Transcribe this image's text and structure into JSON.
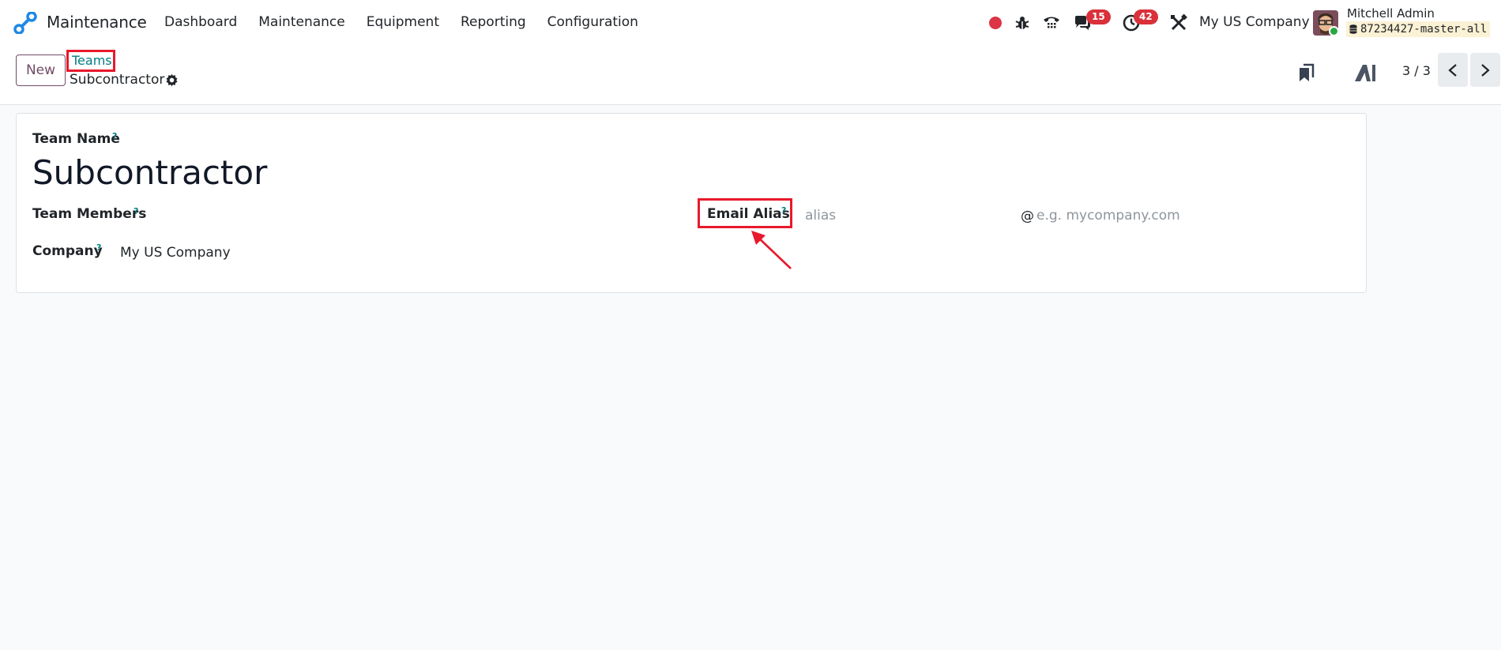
{
  "navbar": {
    "app_name": "Maintenance",
    "menu": [
      "Dashboard",
      "Maintenance",
      "Equipment",
      "Reporting",
      "Configuration"
    ],
    "messages_count": "15",
    "activities_count": "42",
    "company": "My US Company",
    "user_name": "Mitchell Admin",
    "database": "87234427-master-all"
  },
  "breadcrumb": {
    "parent": "Teams",
    "current": "Subcontractor"
  },
  "control_panel": {
    "new_label": "New",
    "pager": "3 / 3"
  },
  "form": {
    "team_name_label": "Team Name",
    "team_name_value": "Subcontractor",
    "team_members_label": "Team Members",
    "company_label": "Company",
    "company_value": "My US Company",
    "email_alias_label": "Email Alias",
    "alias_placeholder": "alias",
    "domain_placeholder": "e.g. mycompany.com",
    "help_mark": "?"
  },
  "colors": {
    "brand": "#714b67",
    "link": "#017e84",
    "annotation_red": "#e8192c",
    "badge_red": "#d9303a"
  }
}
